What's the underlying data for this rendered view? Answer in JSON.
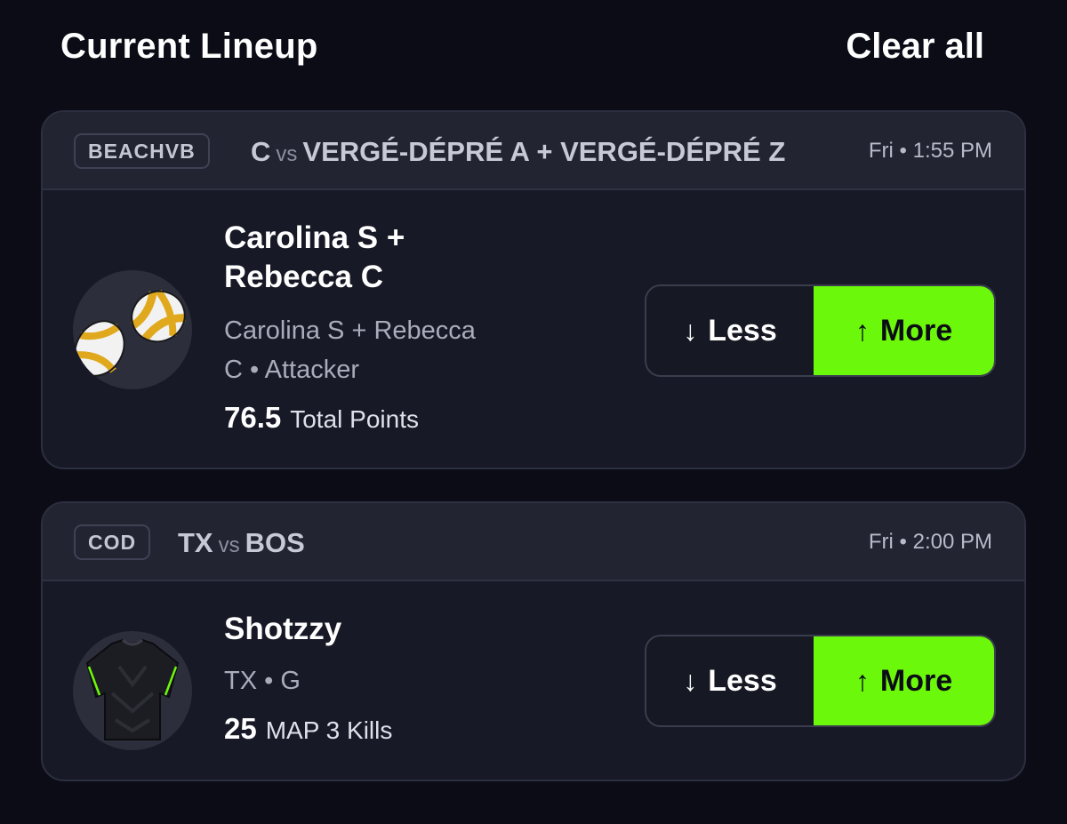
{
  "header": {
    "title": "Current Lineup",
    "clear_all": "Clear all"
  },
  "cards": [
    {
      "league": "BEACHVB",
      "team_a": "C",
      "vs": "vs",
      "team_b": "VERGÉ-DÉPRÉ A + VERGÉ-DÉPRÉ Z",
      "time": "Fri • 1:55 PM",
      "player_name_line1": "Carolina S +",
      "player_name_line2": "Rebecca C",
      "desc_line1": "Carolina S + Rebecca",
      "desc_line2": "C • Attacker",
      "line_value": "76.5",
      "line_stat": "Total Points",
      "avatar_icon": "volleyball-icon",
      "less_label": "Less",
      "more_label": "More"
    },
    {
      "league": "COD",
      "team_a": "TX",
      "vs": "vs",
      "team_b": "BOS",
      "time": "Fri • 2:00 PM",
      "player_name": "Shotzzy",
      "desc": "TX • G",
      "line_value": "25",
      "line_stat": "MAP 3 Kills",
      "avatar_icon": "jersey-icon",
      "less_label": "Less",
      "more_label": "More"
    }
  ],
  "colors": {
    "background": "#0b0c16",
    "card": "#171926",
    "accent": "#6cf80a"
  }
}
